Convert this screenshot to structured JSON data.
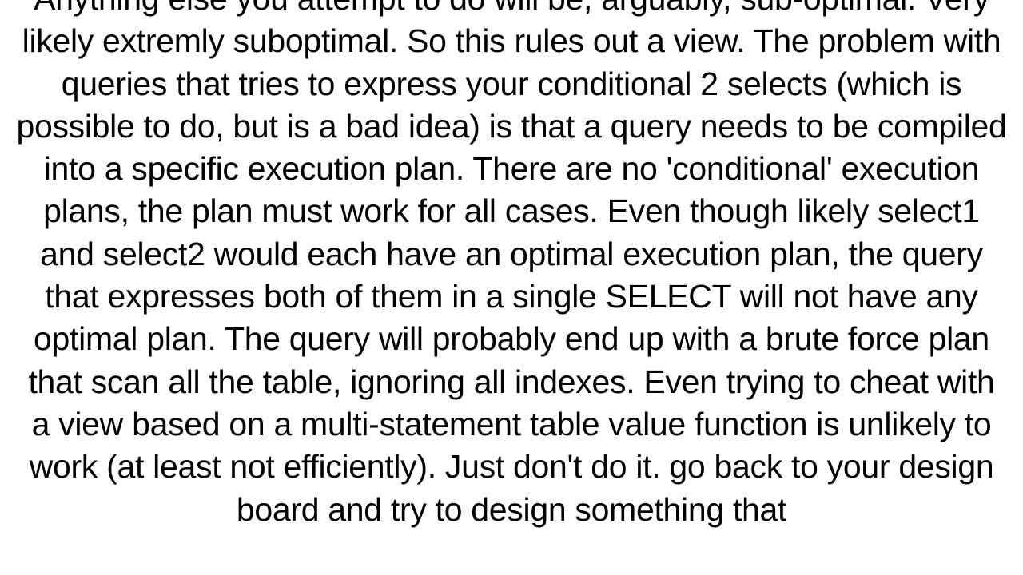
{
  "document": {
    "paragraph": "Anything else you attempt to do will be, arguably, sub-optimal. Very likely extremly suboptimal. So this rules out a view. The problem with queries that tries to express your conditional 2 selects (which is possible to do, but is a bad idea) is that a query needs to be compiled into a specific execution plan. There are no 'conditional' execution plans, the plan must work for all cases. Even though likely select1 and select2 would each have an optimal execution plan, the query that expresses both of them in a single SELECT will not have any optimal plan. The query will probably end up with a brute force plan that scan all the table, ignoring all indexes. Even trying to cheat with a view based on a multi-statement table value function is unlikely to work (at least not efficiently). Just don't do it. go back to your design board and try to design something that"
  }
}
